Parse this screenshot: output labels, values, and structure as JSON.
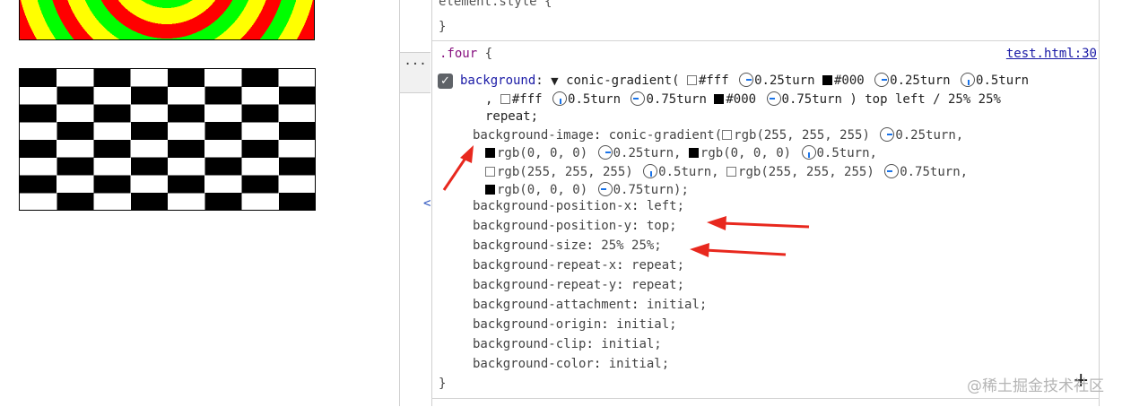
{
  "devtools": {
    "element_style_selector": "element.style {",
    "close_brace": "}",
    "rule": {
      "selector": ".four",
      "open_brace": "{",
      "source": "test.html:30",
      "background": {
        "name": "background",
        "colon": ":",
        "func": "conic-gradient(",
        "line1": [
          {
            "swatch": "#ffffff",
            "text": "#fff"
          },
          {
            "angle": "0.25turn"
          },
          {
            "swatch": "#000000",
            "text": "#000"
          },
          {
            "angle": "0.25turn"
          },
          {
            "angle": "0.5turn"
          }
        ],
        "comma": ",",
        "line2": [
          {
            "swatch": "#ffffff",
            "text": "#fff"
          },
          {
            "angle": "0.5turn"
          },
          {
            "angle": "0.75turn"
          },
          {
            "swatch": "#000000",
            "text": "#000"
          },
          {
            "angle": "0.75turn"
          }
        ],
        "tail": ") top left / 25% 25%",
        "tail2": "repeat;"
      },
      "background_image": {
        "name": "background-image",
        "func": "conic-gradient(",
        "stops": [
          {
            "rgb": "rgb(255, 255, 255)",
            "angle": "0.25turn",
            "sep": ","
          },
          {
            "rgb": "rgb(0, 0, 0)",
            "angle": "0.25turn",
            "sep": ","
          },
          {
            "rgb": "rgb(0, 0, 0)",
            "angle": "0.5turn",
            "sep": ","
          },
          {
            "rgb": "rgb(255, 255, 255)",
            "angle": "0.5turn",
            "sep": ","
          },
          {
            "rgb": "rgb(255, 255, 255)",
            "angle": "0.75turn",
            "sep": ","
          },
          {
            "rgb": "rgb(0, 0, 0)",
            "angle": "0.75turn",
            "sep": ");"
          }
        ]
      },
      "longhands": [
        {
          "name": "background-position-x",
          "value": "left;"
        },
        {
          "name": "background-position-y",
          "value": "top;"
        },
        {
          "name": "background-size",
          "value": "25% 25%;"
        },
        {
          "name": "background-repeat-x",
          "value": "repeat;"
        },
        {
          "name": "background-repeat-y",
          "value": "repeat;"
        },
        {
          "name": "background-attachment",
          "value": "initial;"
        },
        {
          "name": "background-origin",
          "value": "initial;"
        },
        {
          "name": "background-clip",
          "value": "initial;"
        },
        {
          "name": "background-color",
          "value": "initial;"
        }
      ],
      "end_brace": "}"
    },
    "more_button": "···",
    "lt_glyph": "<"
  },
  "watermark": "@稀土掘金技术社区",
  "colors": {
    "selector": "#881280",
    "property": "#1a1aa6",
    "annotation_arrow": "#e8281e"
  }
}
